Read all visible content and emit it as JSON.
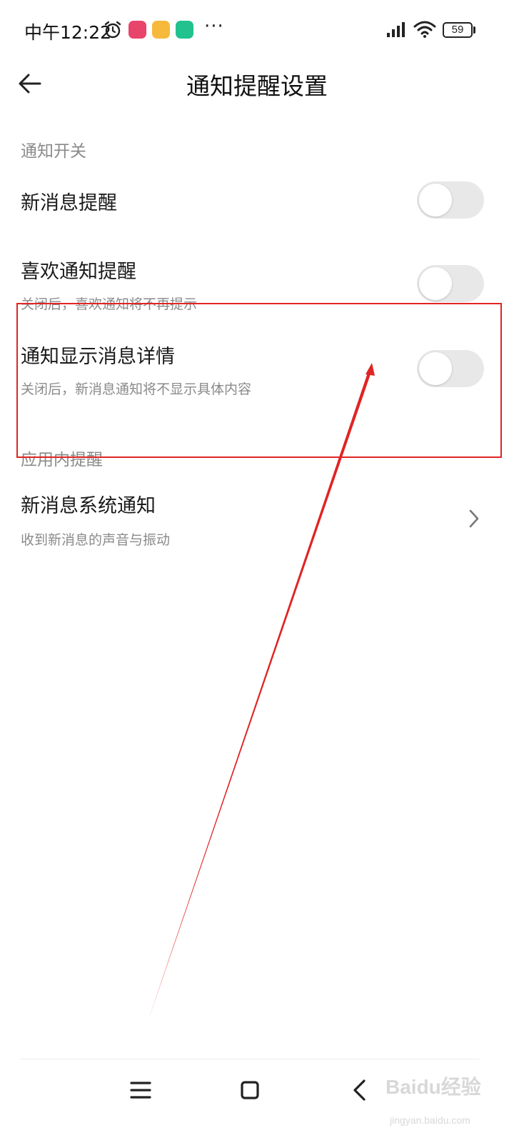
{
  "status_bar": {
    "time": "中午12:22",
    "more": "···",
    "battery": "59"
  },
  "header": {
    "title": "通知提醒设置"
  },
  "sections": [
    {
      "title": "通知开关",
      "rows": [
        {
          "title": "新消息提醒",
          "subtitle": "",
          "enabled": false
        },
        {
          "title": "喜欢通知提醒",
          "subtitle": "关闭后，喜欢通知将不再提示",
          "enabled": false
        },
        {
          "title": "通知显示消息详情",
          "subtitle": "关闭后，新消息通知将不显示具体内容",
          "enabled": false
        }
      ]
    },
    {
      "title": "应用内提醒",
      "rows": [
        {
          "title": "新消息系统通知",
          "subtitle": "收到新消息的声音与振动"
        }
      ]
    }
  ],
  "watermark": {
    "brand": "Baidu经验",
    "url": "jingyan.baidu.com"
  },
  "colors": {
    "annotation": "#e02424",
    "toggle_off": "#e8e8e8",
    "secondary_text": "#8a8a8a"
  }
}
